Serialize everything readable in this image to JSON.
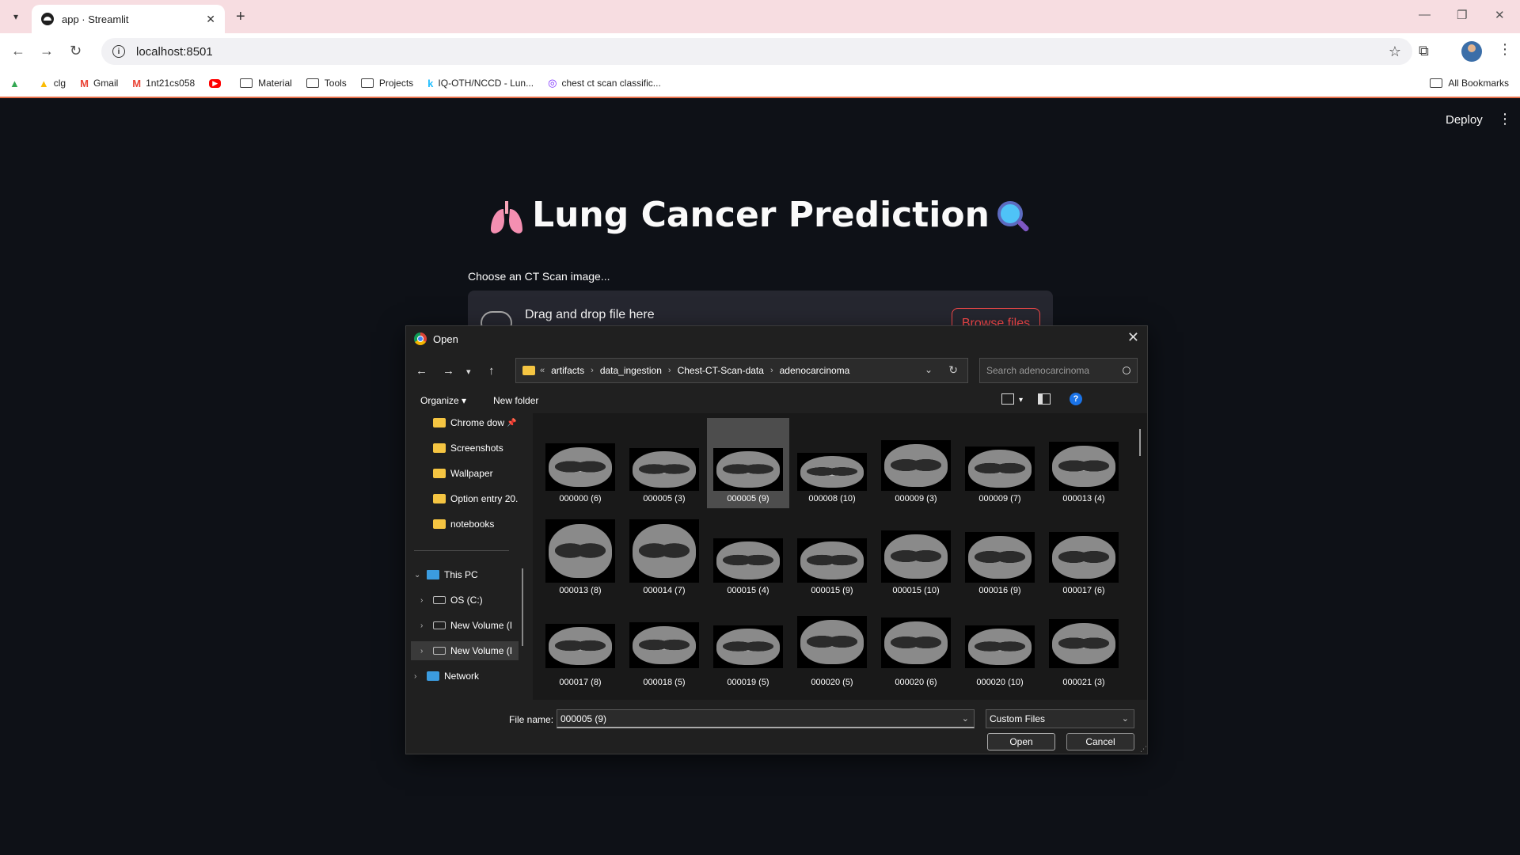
{
  "browser": {
    "tab_title": "app · Streamlit",
    "url": "localhost:8501",
    "bookmarks": [
      {
        "label": "",
        "icon": "google-drive-icon"
      },
      {
        "label": "clg",
        "icon": "google-drive-icon"
      },
      {
        "label": "Gmail",
        "icon": "gmail-icon"
      },
      {
        "label": "1nt21cs058",
        "icon": "gmail-icon"
      },
      {
        "label": "",
        "icon": "youtube-icon"
      },
      {
        "label": "Material",
        "icon": "folder-icon"
      },
      {
        "label": "Tools",
        "icon": "folder-icon"
      },
      {
        "label": "Projects",
        "icon": "folder-icon"
      },
      {
        "label": "IQ-OTH/NCCD - Lun...",
        "icon": "kaggle-icon"
      },
      {
        "label": "chest ct scan classific...",
        "icon": "replicate-icon"
      }
    ],
    "all_bookmarks": "All Bookmarks"
  },
  "streamlit": {
    "deploy_label": "Deploy",
    "title": "Lung Cancer Prediction",
    "uploader_label": "Choose an CT Scan image...",
    "drop_text": "Drag and drop file here",
    "browse_label": "Browse files"
  },
  "dialog": {
    "title": "Open",
    "path": [
      "artifacts",
      "data_ingestion",
      "Chest-CT-Scan-data",
      "adenocarcinoma"
    ],
    "search_placeholder": "Search adenocarcinoma",
    "organize_label": "Organize",
    "new_folder_label": "New folder",
    "nav_quick": [
      "Chrome dow",
      "Screenshots",
      "Wallpaper",
      "Option entry 20.",
      "notebooks"
    ],
    "nav_tree": [
      {
        "label": "This PC",
        "icon": "this-pc-icon"
      },
      {
        "label": "OS (C:)",
        "icon": "drive-icon"
      },
      {
        "label": "New Volume (I",
        "icon": "drive-icon"
      },
      {
        "label": "New Volume (I",
        "icon": "drive-icon"
      },
      {
        "label": "Network",
        "icon": "network-icon"
      }
    ],
    "files": [
      "000000 (6)",
      "000005 (3)",
      "000005 (9)",
      "000008 (10)",
      "000009 (3)",
      "000009 (7)",
      "000013 (4)",
      "000013 (8)",
      "000014 (7)",
      "000015 (4)",
      "000015 (9)",
      "000015 (10)",
      "000016 (9)",
      "000017 (6)",
      "000017 (8)",
      "000018 (5)",
      "000019 (5)",
      "000020 (5)",
      "000020 (6)",
      "000020 (10)",
      "000021 (3)"
    ],
    "selected_file": "000005 (9)",
    "file_name_label": "File name:",
    "file_name_value": "000005 (9)",
    "file_type_value": "Custom Files",
    "open_label": "Open",
    "cancel_label": "Cancel"
  }
}
